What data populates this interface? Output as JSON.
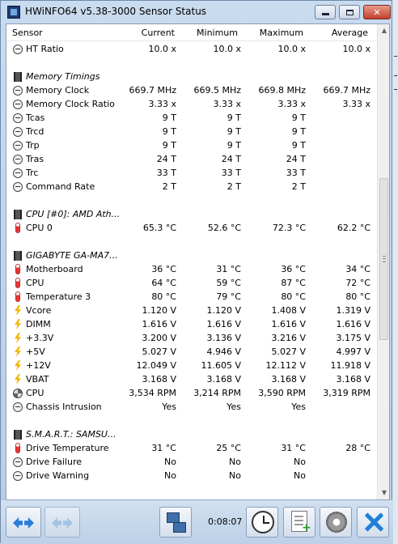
{
  "window": {
    "title": "HWiNFO64 v5.38-3000 Sensor Status",
    "min_label": "",
    "max_label": "",
    "close_label": "✕"
  },
  "columns": {
    "sensor": "Sensor",
    "current": "Current",
    "minimum": "Minimum",
    "maximum": "Maximum",
    "average": "Average"
  },
  "rows": [
    {
      "type": "data",
      "icon": "clock-icon",
      "label": "HT Ratio",
      "current": "10.0 x",
      "minimum": "10.0 x",
      "maximum": "10.0 x",
      "average": "10.0 x"
    },
    {
      "type": "spacer"
    },
    {
      "type": "group",
      "icon": "chip-icon",
      "label": "Memory Timings"
    },
    {
      "type": "data",
      "icon": "clock-icon",
      "label": "Memory Clock",
      "current": "669.7 MHz",
      "minimum": "669.5 MHz",
      "maximum": "669.8 MHz",
      "average": "669.7 MHz"
    },
    {
      "type": "data",
      "icon": "clock-icon",
      "label": "Memory Clock Ratio",
      "current": "3.33 x",
      "minimum": "3.33 x",
      "maximum": "3.33 x",
      "average": "3.33 x"
    },
    {
      "type": "data",
      "icon": "clock-icon",
      "label": "Tcas",
      "current": "9 T",
      "minimum": "9 T",
      "maximum": "9 T",
      "average": ""
    },
    {
      "type": "data",
      "icon": "clock-icon",
      "label": "Trcd",
      "current": "9 T",
      "minimum": "9 T",
      "maximum": "9 T",
      "average": ""
    },
    {
      "type": "data",
      "icon": "clock-icon",
      "label": "Trp",
      "current": "9 T",
      "minimum": "9 T",
      "maximum": "9 T",
      "average": ""
    },
    {
      "type": "data",
      "icon": "clock-icon",
      "label": "Tras",
      "current": "24 T",
      "minimum": "24 T",
      "maximum": "24 T",
      "average": ""
    },
    {
      "type": "data",
      "icon": "clock-icon",
      "label": "Trc",
      "current": "33 T",
      "minimum": "33 T",
      "maximum": "33 T",
      "average": ""
    },
    {
      "type": "data",
      "icon": "clock-icon",
      "label": "Command Rate",
      "current": "2 T",
      "minimum": "2 T",
      "maximum": "2 T",
      "average": ""
    },
    {
      "type": "spacer"
    },
    {
      "type": "group",
      "icon": "chip-icon",
      "label": "CPU [#0]: AMD Ath..."
    },
    {
      "type": "data",
      "icon": "thermometer-icon",
      "label": "CPU 0",
      "current": "65.3 °C",
      "minimum": "52.6 °C",
      "maximum": "72.3 °C",
      "average": "62.2 °C"
    },
    {
      "type": "spacer"
    },
    {
      "type": "group",
      "icon": "chip-icon",
      "label": "GIGABYTE GA-MA7..."
    },
    {
      "type": "data",
      "icon": "thermometer-icon",
      "label": "Motherboard",
      "current": "36 °C",
      "minimum": "31 °C",
      "maximum": "36 °C",
      "average": "34 °C"
    },
    {
      "type": "data",
      "icon": "thermometer-icon",
      "label": "CPU",
      "current": "64 °C",
      "minimum": "59 °C",
      "maximum": "87 °C",
      "average": "72 °C"
    },
    {
      "type": "data",
      "icon": "thermometer-icon",
      "label": "Temperature 3",
      "current": "80 °C",
      "minimum": "79 °C",
      "maximum": "80 °C",
      "average": "80 °C"
    },
    {
      "type": "data",
      "icon": "voltage-bolt-icon",
      "label": "Vcore",
      "current": "1.120 V",
      "minimum": "1.120 V",
      "maximum": "1.408 V",
      "average": "1.319 V"
    },
    {
      "type": "data",
      "icon": "voltage-bolt-icon",
      "label": "DIMM",
      "current": "1.616 V",
      "minimum": "1.616 V",
      "maximum": "1.616 V",
      "average": "1.616 V"
    },
    {
      "type": "data",
      "icon": "voltage-bolt-icon",
      "label": "+3.3V",
      "current": "3.200 V",
      "minimum": "3.136 V",
      "maximum": "3.216 V",
      "average": "3.175 V"
    },
    {
      "type": "data",
      "icon": "voltage-bolt-icon",
      "label": "+5V",
      "current": "5.027 V",
      "minimum": "4.946 V",
      "maximum": "5.027 V",
      "average": "4.997 V"
    },
    {
      "type": "data",
      "icon": "voltage-bolt-icon",
      "label": "+12V",
      "current": "12.049 V",
      "minimum": "11.605 V",
      "maximum": "12.112 V",
      "average": "11.918 V"
    },
    {
      "type": "data",
      "icon": "voltage-bolt-icon",
      "label": "VBAT",
      "current": "3.168 V",
      "minimum": "3.168 V",
      "maximum": "3.168 V",
      "average": "3.168 V"
    },
    {
      "type": "data",
      "icon": "fan-icon",
      "label": "CPU",
      "current": "3,534 RPM",
      "minimum": "3,214 RPM",
      "maximum": "3,590 RPM",
      "average": "3,319 RPM"
    },
    {
      "type": "data",
      "icon": "clock-icon",
      "label": "Chassis Intrusion",
      "current": "Yes",
      "minimum": "Yes",
      "maximum": "Yes",
      "average": ""
    },
    {
      "type": "spacer"
    },
    {
      "type": "group",
      "icon": "chip-icon",
      "label": "S.M.A.R.T.: SAMSU..."
    },
    {
      "type": "data",
      "icon": "thermometer-icon",
      "label": "Drive Temperature",
      "current": "31 °C",
      "minimum": "25 °C",
      "maximum": "31 °C",
      "average": "28 °C"
    },
    {
      "type": "data",
      "icon": "clock-icon",
      "label": "Drive Failure",
      "current": "No",
      "minimum": "No",
      "maximum": "No",
      "average": ""
    },
    {
      "type": "data",
      "icon": "clock-icon",
      "label": "Drive Warning",
      "current": "No",
      "minimum": "No",
      "maximum": "No",
      "average": ""
    }
  ],
  "toolbar": {
    "elapsed_time": "0:08:07"
  },
  "colors": {
    "accent_blue": "#1f7fd9",
    "window_frame": "#b7cde6"
  }
}
